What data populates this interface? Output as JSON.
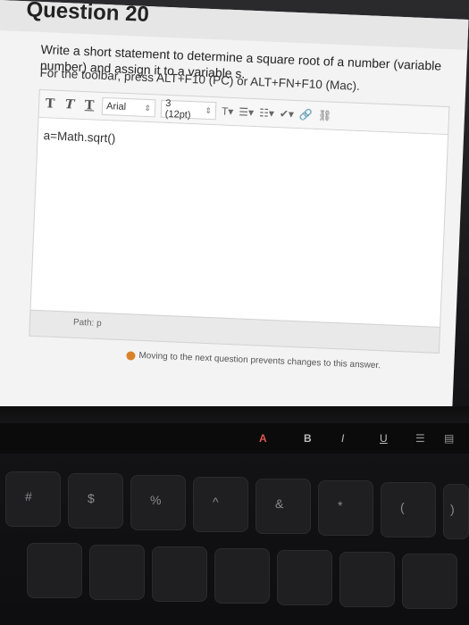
{
  "question": {
    "number": "Question 20",
    "prompt": "Write a short statement to determine a square root of a number (variable number) and assign it to a variable s.",
    "instruction": "For the toolbar, press ALT+F10 (PC) or ALT+FN+F10 (Mac)."
  },
  "toolbar": {
    "bold": "T",
    "italic": "T",
    "underline": "T",
    "font_family": "Arial",
    "font_size": "3 (12pt)"
  },
  "editor": {
    "content": "a=Math.sqrt()"
  },
  "pathbar": {
    "path": "Path: p"
  },
  "warning": {
    "text": "Moving to the next question prevents changes to this answer."
  },
  "touchbar": {
    "glyphs": [
      "A",
      "B",
      "I",
      "U"
    ]
  },
  "keyboard": {
    "labels": [
      "#",
      "$",
      "%",
      "^",
      "&",
      "*",
      "(",
      ")"
    ]
  }
}
